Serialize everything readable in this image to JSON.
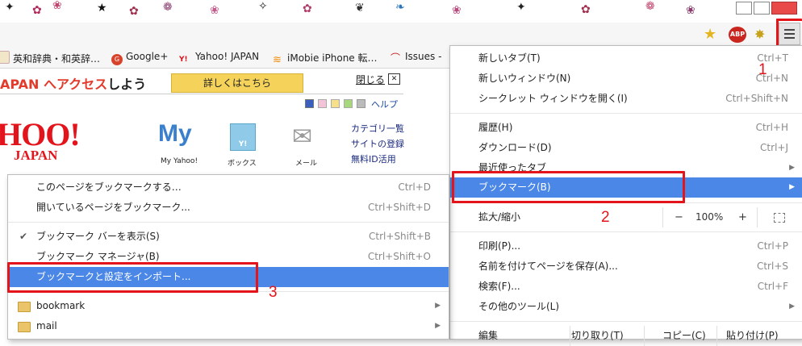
{
  "toolbar": {
    "menu_icon": "hamburger-menu-icon",
    "star_icon": "star-icon",
    "abp_label": "ABP",
    "extension_icon": "gear-flower-icon"
  },
  "bookmarks_bar": [
    {
      "label": "英和辞典・和英辞…",
      "icon": "book-icon"
    },
    {
      "label": "Google+",
      "icon": "google-plus-icon"
    },
    {
      "label": "Yahoo! JAPAN",
      "icon": "yahoo-icon"
    },
    {
      "label": "iMobie iPhone 転…",
      "icon": "wifi-icon"
    },
    {
      "label": "Issues -",
      "icon": "issues-icon"
    }
  ],
  "page": {
    "banner_text_part1": "APAN へアクセス",
    "banner_text_part2": "しよう",
    "banner_button": "詳しくはこちら",
    "close_label": "閉じる",
    "close_x": "✕",
    "help": "ヘルプ",
    "logo_line1": "HOO!",
    "logo_line2": "JAPAN",
    "icons": [
      {
        "label": "My Yahoo!",
        "glyph": "My"
      },
      {
        "label": "ボックス",
        "glyph": "Y!"
      },
      {
        "label": "メール",
        "glyph": "✉"
      }
    ],
    "links": [
      "カテゴリ一覧",
      "サイトの登録",
      "無料ID活用"
    ]
  },
  "main_menu": {
    "items": [
      {
        "label": "新しいタブ(T)",
        "shortcut": "Ctrl+T"
      },
      {
        "label": "新しいウィンドウ(N)",
        "shortcut": "Ctrl+N"
      },
      {
        "label": "シークレット ウィンドウを開く(I)",
        "shortcut": "Ctrl+Shift+N"
      },
      {
        "label": "履歴(H)",
        "shortcut": "Ctrl+H"
      },
      {
        "label": "ダウンロード(D)",
        "shortcut": "Ctrl+J"
      },
      {
        "label": "最近使ったタブ",
        "shortcut": ""
      },
      {
        "label": "ブックマーク(B)",
        "shortcut": ""
      },
      {
        "label": "拡大/縮小",
        "shortcut": ""
      },
      {
        "label": "印刷(P)...",
        "shortcut": "Ctrl+P"
      },
      {
        "label": "名前を付けてページを保存(A)...",
        "shortcut": "Ctrl+S"
      },
      {
        "label": "検索(F)...",
        "shortcut": "Ctrl+F"
      },
      {
        "label": "その他のツール(L)",
        "shortcut": ""
      },
      {
        "label": "編集",
        "shortcut": ""
      }
    ],
    "zoom": {
      "minus": "−",
      "value": "100%",
      "plus": "+"
    },
    "edit": {
      "cut": "切り取り(T)",
      "copy": "コピー(C)",
      "paste": "貼り付け(P)"
    }
  },
  "bookmark_submenu": {
    "items": [
      {
        "label": "このページをブックマークする…",
        "shortcut": "Ctrl+D"
      },
      {
        "label": "開いているページをブックマーク...",
        "shortcut": "Ctrl+Shift+D"
      },
      {
        "label": "ブックマーク バーを表示(S)",
        "shortcut": "Ctrl+Shift+B",
        "checked": "✔"
      },
      {
        "label": "ブックマーク マネージャ(B)",
        "shortcut": "Ctrl+Shift+O"
      },
      {
        "label": "ブックマークと設定をインポート...",
        "shortcut": ""
      },
      {
        "label": "bookmark",
        "shortcut": ""
      },
      {
        "label": "mail",
        "shortcut": ""
      }
    ]
  },
  "annotations": {
    "step1": "1",
    "step2": "2",
    "step3": "3"
  },
  "colors": {
    "highlight": "#4a87e6",
    "annotation_red": "#e3151a",
    "banner_button": "#f5d35a"
  }
}
